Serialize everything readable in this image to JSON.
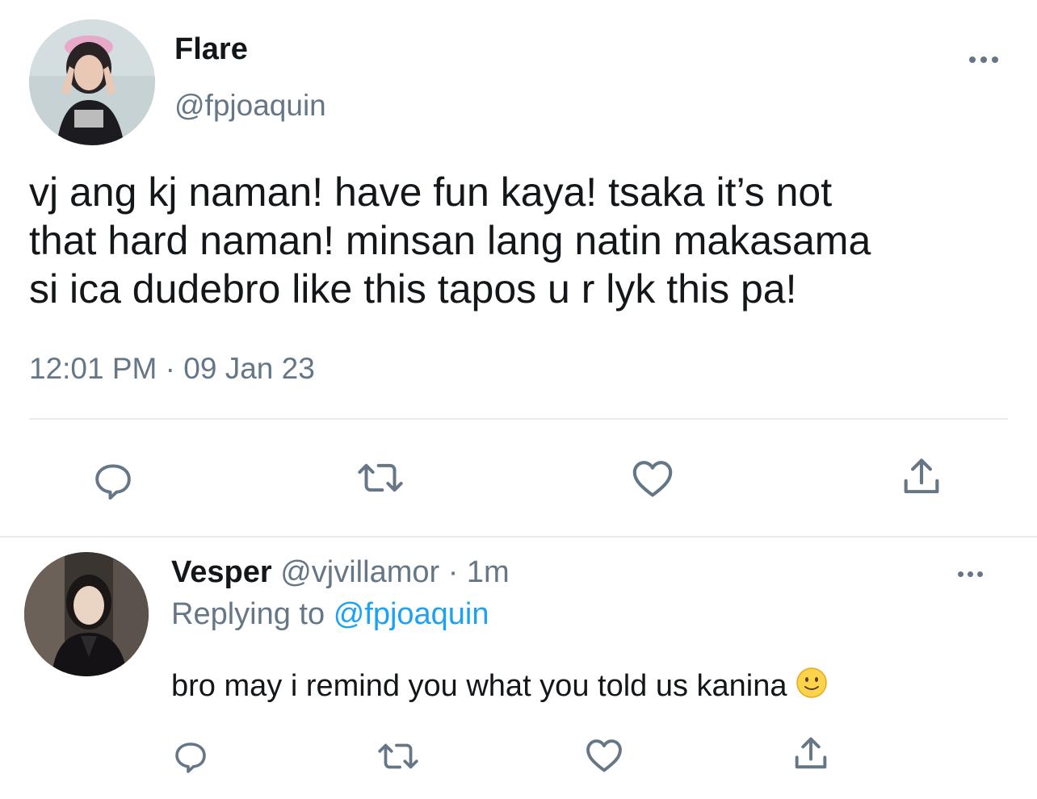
{
  "main_tweet": {
    "author_name": "Flare",
    "author_handle": "@fpjoaquin",
    "text": "vj ang kj naman! have fun kaya! tsaka it’s not\nthat hard naman! minsan lang natin makasama\nsi ica dudebro like this tapos u r lyk this pa!",
    "time": "12:01 PM",
    "separator": "·",
    "date": "09 Jan 23"
  },
  "reply": {
    "author_name": "Vesper",
    "author_handle": "@vjvillamor",
    "separator": "·",
    "time": "1m",
    "replying_label": "Replying to",
    "replying_handle": "@fpjoaquin",
    "text": "bro may i remind you what you told us kanina",
    "emoji": "slightly-smiling-face"
  },
  "icons": {
    "more": "more-horizontal-icon",
    "reply": "reply-icon",
    "retweet": "retweet-icon",
    "like": "like-icon",
    "share": "share-icon"
  },
  "colors": {
    "text": "#14171a",
    "secondary": "#657786",
    "link": "#1da1f2",
    "divider": "#e6ecf0"
  }
}
